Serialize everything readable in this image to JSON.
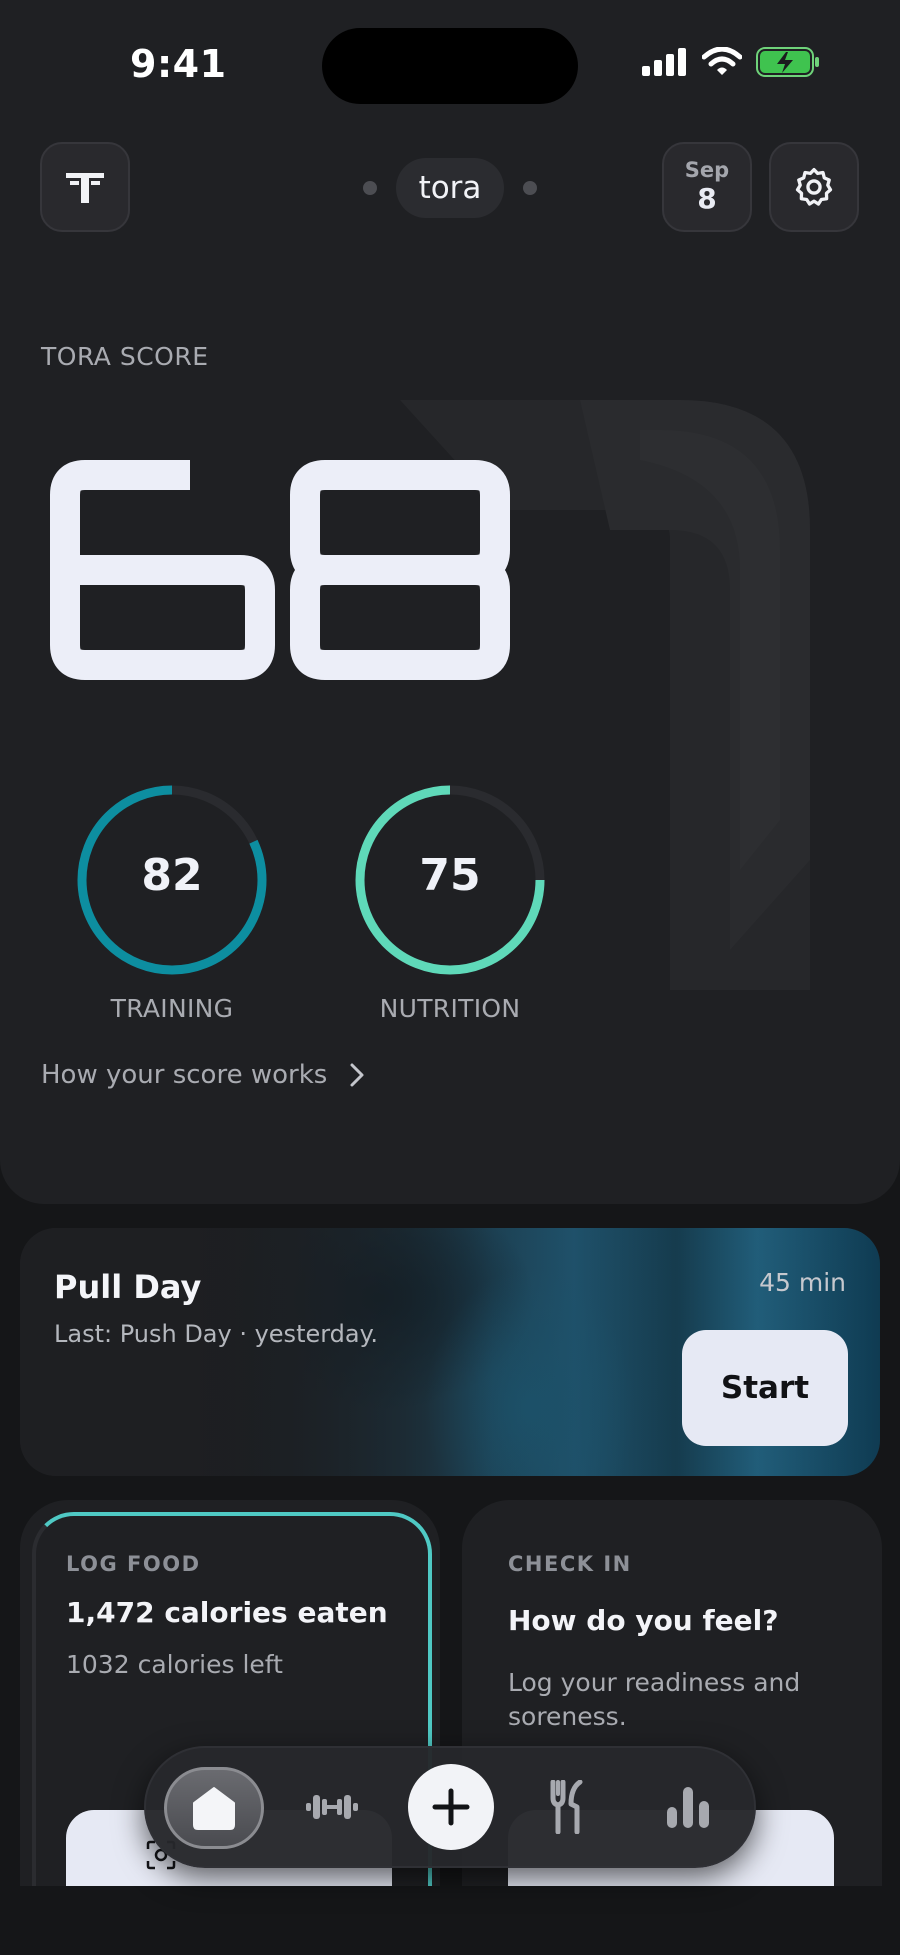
{
  "status_bar": {
    "time": "9:41"
  },
  "header": {
    "brand": "tora",
    "date_month": "Sep",
    "date_day": "8"
  },
  "score": {
    "label": "TORA SCORE",
    "value": "68",
    "training": {
      "value": "82",
      "label": "TRAINING",
      "progress": 0.82,
      "color": "#0d8ea0"
    },
    "nutrition": {
      "value": "75",
      "label": "NUTRITION",
      "progress": 0.75,
      "color": "#5fd9b9"
    },
    "how_link": "How your score works"
  },
  "workout": {
    "title": "Pull Day",
    "subtitle": "Last: Push Day · yesterday.",
    "duration": "45 min",
    "start_label": "Start"
  },
  "log_food": {
    "eyebrow": "LOG FOOD",
    "title": "1,472 calories eaten",
    "subtitle": "1032 calories left"
  },
  "check_in": {
    "eyebrow": "CHECK IN",
    "title": "How do you feel?",
    "subtitle": "Log your readiness and soreness."
  },
  "tabbar": {
    "items": [
      "home-icon",
      "dumbbell-icon",
      "plus-icon",
      "fork-knife-icon",
      "bar-chart-icon"
    ],
    "active": "home-icon"
  }
}
